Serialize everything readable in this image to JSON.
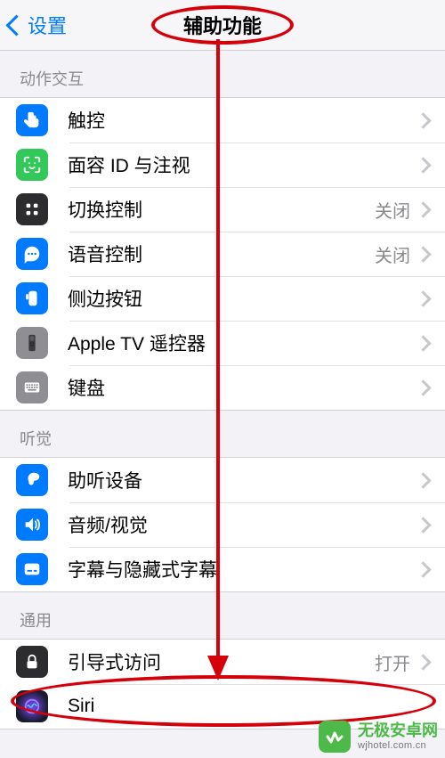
{
  "nav": {
    "back_label": "设置",
    "title": "辅助功能"
  },
  "sections": {
    "motion": {
      "header": "动作交互"
    },
    "hearing": {
      "header": "听觉"
    },
    "general": {
      "header": "通用"
    }
  },
  "rows": {
    "touch": {
      "label": "触控"
    },
    "faceid": {
      "label": "面容 ID 与注视"
    },
    "switch": {
      "label": "切换控制",
      "status": "关闭"
    },
    "voice": {
      "label": "语音控制",
      "status": "关闭"
    },
    "sidebutton": {
      "label": "侧边按钮"
    },
    "appletv": {
      "label": "Apple TV 遥控器"
    },
    "keyboard": {
      "label": "键盘"
    },
    "hearing_dev": {
      "label": "助听设备"
    },
    "av": {
      "label": "音频/视觉"
    },
    "subtitles": {
      "label": "字幕与隐藏式字幕"
    },
    "guided": {
      "label": "引导式访问",
      "status": "打开"
    },
    "siri": {
      "label": "Siri"
    }
  },
  "watermark": {
    "line1": "无极安卓网",
    "line2": "wjhotel.com.cn"
  }
}
